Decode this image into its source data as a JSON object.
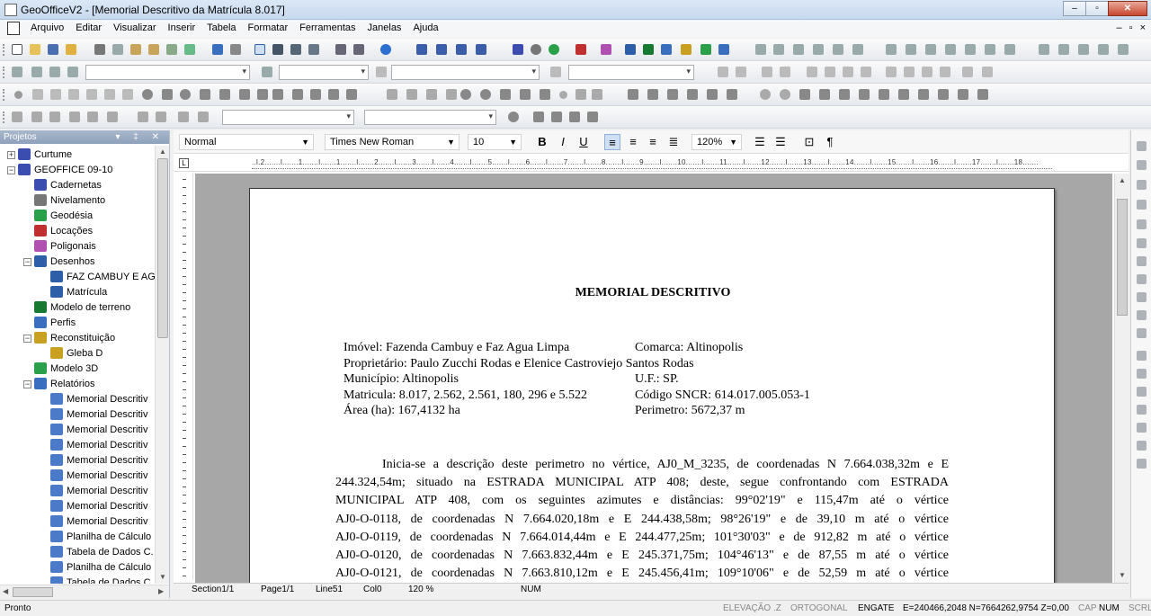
{
  "window": {
    "title": "GeoOfficeV2 - [Memorial Descritivo da Matrícula 8.017]",
    "minimize": "‒",
    "maximize": "▫",
    "close": "✕"
  },
  "menu": [
    "Arquivo",
    "Editar",
    "Visualizar",
    "Inserir",
    "Tabela",
    "Formatar",
    "Ferramentas",
    "Janelas",
    "Ajuda"
  ],
  "mdi_controls": [
    "–",
    "▫",
    "×"
  ],
  "projects": {
    "header": "Projetos",
    "items": [
      {
        "label": "Curtume"
      },
      {
        "label": "GEOFFICE 09-10"
      },
      {
        "label": "Cadernetas"
      },
      {
        "label": "Nivelamento"
      },
      {
        "label": "Geodésia"
      },
      {
        "label": "Locações"
      },
      {
        "label": "Poligonais"
      },
      {
        "label": "Desenhos"
      },
      {
        "label": "FAZ CAMBUY E AG"
      },
      {
        "label": "Matrícula"
      },
      {
        "label": "Modelo de terreno"
      },
      {
        "label": "Perfis"
      },
      {
        "label": "Reconstituição"
      },
      {
        "label": "Gleba D"
      },
      {
        "label": "Modelo 3D"
      },
      {
        "label": "Relatórios"
      },
      {
        "label": "Memorial Descritiv"
      },
      {
        "label": "Memorial Descritiv"
      },
      {
        "label": "Memorial Descritiv"
      },
      {
        "label": "Memorial Descritiv"
      },
      {
        "label": "Memorial Descritiv"
      },
      {
        "label": "Memorial Descritiv"
      },
      {
        "label": "Memorial Descritiv"
      },
      {
        "label": "Memorial Descritiv"
      },
      {
        "label": "Memorial Descritiv"
      },
      {
        "label": "Planilha de Cálculo"
      },
      {
        "label": "Tabela de Dados C."
      },
      {
        "label": "Planilha de Cálculo"
      },
      {
        "label": "Tabela de Dados C."
      }
    ]
  },
  "format": {
    "style": "Normal",
    "font": "Times New Roman",
    "size": "10",
    "zoom": "120%",
    "bold": "B",
    "italic": "I",
    "underline": "U"
  },
  "ruler_text": "..l.2.......l.......1.......l.......1.......l.......2.......l.......3.......l.......4.......l.......5.......l.......6.......l.......7.......l.......8.......l.......9.......l.......10.......l.......11.......l.......12.......l.......13.......l.......14.......l.......15.......l.......16.......l.......17.......l.......18.......",
  "document": {
    "title": "MEMORIAL DESCRITIVO",
    "left": [
      "Imóvel: Fazenda Cambuy e Faz Agua Limpa",
      "Proprietário: Paulo Zucchi Rodas  e Elenice Castroviejo Santos Rodas",
      "Município: Altinopolis",
      "Matricula: 8.017, 2.562, 2.561, 180, 296 e 5.522",
      "Área (ha):  167,4132 ha"
    ],
    "right": [
      "Comarca: Altinopolis",
      "",
      "U.F.: SP.",
      "Código SNCR: 614.017.005.053-1",
      "Perimetro: 5672,37 m"
    ],
    "paragraph": [
      "Inicia-se a descrição deste perimetro no vértice, AJ0_M_3235, de coordenadas N  7.664.038,32m e E",
      "244.324,54m;  situado na ESTRADA  MUNICIPAL    ATP 408;  deste, segue confrontando com ESTRADA",
      "MUNICIPAL    ATP 408,  com os seguintes azimutes e distâncias:     99°02'19\"  e    115,47m  até o vértice",
      "AJ0-O-0118,  de coordenadas  N   7.664.020,18m e  E    244.438,58m;  98°26'19\"  e de    39,10  m até o vértice",
      "AJ0-O-0119,  de coordenadas  N   7.664.014,44m e  E    244.477,25m;    101°30'03\"  e de    912,82  m até o vértice",
      "AJ0-O-0120,  de coordenadas  N   7.663.832,44m e  E    245.371,75m;    104°46'13\"  e de    87,55  m até o vértice",
      "AJ0-O-0121,  de coordenadas  N   7.663.810,12m e  E    245.456,41m;    109°10'06\"  e de    52,59  m até o vértice"
    ]
  },
  "editor_status": {
    "section": "Section1/1",
    "page": "Page1/1",
    "line": "Line51",
    "col": "Col0",
    "zoom": "120 %",
    "num": "NUM"
  },
  "status": {
    "ready": "Pronto",
    "elevacao": "ELEVAÇÃO .Z",
    "ortogonal": "ORTOGONAL",
    "engate": "ENGATE",
    "coords": "E=240466,2048 N=7664262,9754 Z=0,00",
    "cap": "CAP",
    "num": "NUM",
    "scrl": "SCRL"
  }
}
